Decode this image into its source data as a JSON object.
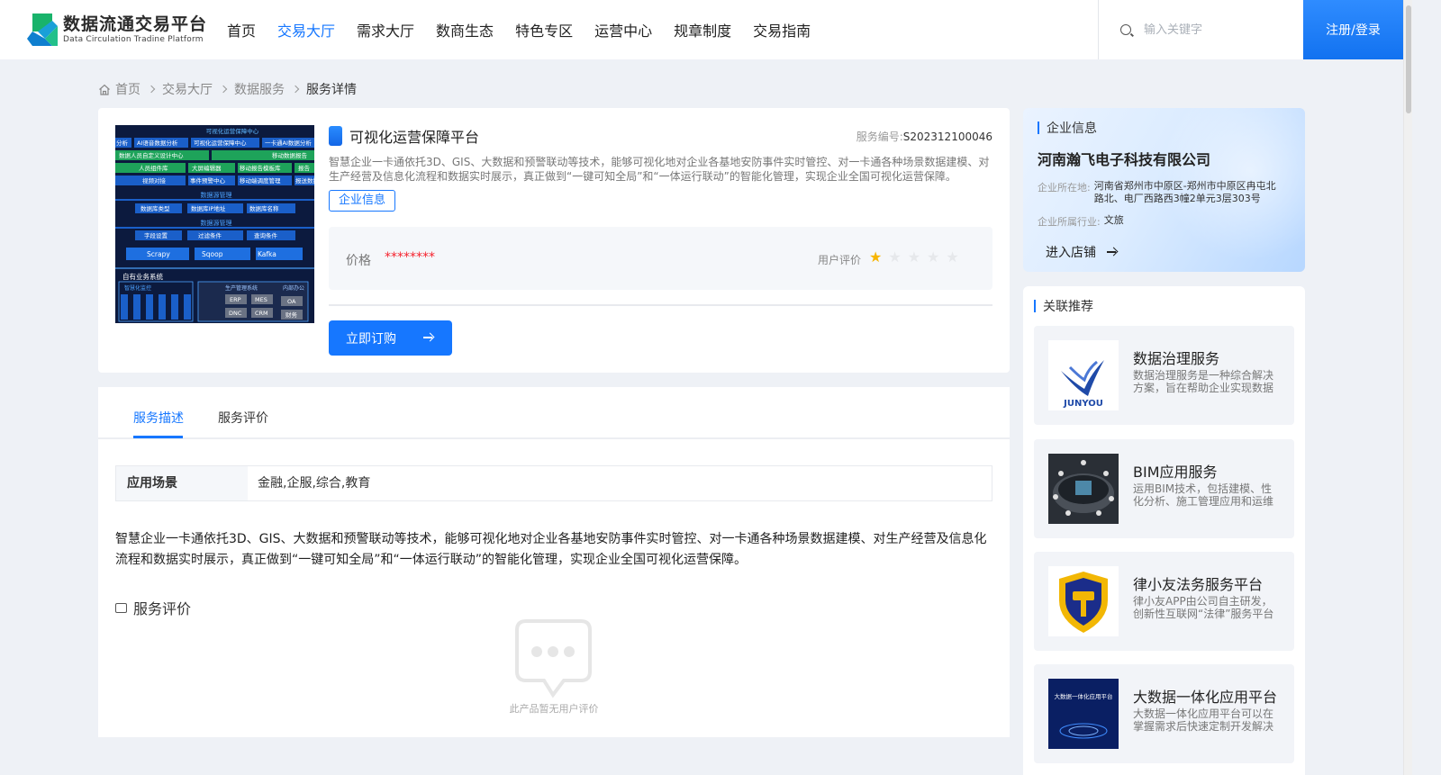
{
  "header": {
    "logo_title": "数据流通交易平台",
    "logo_sub": "Data Circulation Tradine Platform",
    "nav": [
      "首页",
      "交易大厅",
      "需求大厅",
      "数商生态",
      "特色专区",
      "运营中心",
      "规章制度",
      "交易指南"
    ],
    "active_nav": "交易大厅",
    "search_placeholder": "输入关键字",
    "login_label": "注册/登录"
  },
  "breadcrumb": [
    "首页",
    "交易大厅",
    "数据服务",
    "服务详情"
  ],
  "product": {
    "title": "可视化运营保障平台",
    "code_label": "服务编号:",
    "code": "S202312100046",
    "description": "智慧企业一卡通依托3D、GIS、大数据和预警联动等技术，能够可视化地对企业各基地安防事件实时管控、对一卡通各种场景数据建模、对生产经营及信息化流程和数据实时展示，真正做到“一键可知全局”和“一体运行联动”的智能化管理，实现企业全国可视化运营保障。",
    "enterprise_tag": "企业信息",
    "price_label": "价格",
    "price_value": "********",
    "rating_label": "用户评价",
    "rating": 1,
    "rating_max": 5,
    "order_label": "立即订购",
    "thumbnail": {
      "header_text": "可视化运营保障中心",
      "row1": [
        "分析",
        "AI语音数据分析",
        "可视化运营保障中心",
        "一卡通AI数据分析"
      ],
      "row2": [
        "数据人员自定义设计中心",
        "移动数据报告"
      ],
      "row3": [
        "人员组件库",
        "大屏编辑器",
        "移动报告模板库",
        "报告"
      ],
      "row4": [
        "视频对接",
        "事件预警中心",
        "移动端调度管理",
        "报送数据"
      ],
      "sec2": "数据源管理",
      "row5": [
        "数据库类型",
        "数据库IP地址",
        "数据库名称"
      ],
      "sec3": "数据源管理",
      "row6": [
        "字段设置",
        "过滤条件",
        "查询条件"
      ],
      "row7": [
        "Scrapy",
        "Sqoop",
        "Kafka"
      ],
      "sec4": "自有业务系统",
      "sub1": "智慧化监控",
      "sub2": "生产管理系统",
      "sub3": "内部办公",
      "modules": [
        "ERP",
        "MES",
        "DNC",
        "CRM",
        "OA",
        "财务"
      ]
    }
  },
  "detail": {
    "tabs": [
      "服务描述",
      "服务评价"
    ],
    "active_tab": "服务描述",
    "scene_label": "应用场景",
    "scene_value": "金融,企服,综合,教育",
    "full_description": "智慧企业一卡通依托3D、GIS、大数据和预警联动等技术，能够可视化地对企业各基地安防事件实时管控、对一卡通各种场景数据建模、对生产经营及信息化流程和数据实时展示，真正做到“一键可知全局”和“一体运行联动”的智能化管理，实现企业全国可视化运营保障。",
    "review_title": "服务评价",
    "empty_text": "此产品暂无用户评价"
  },
  "company": {
    "section_title": "企业信息",
    "name": "河南瀚飞电子科技有限公司",
    "location_label": "企业所在地:",
    "location": "河南省郑州市中原区-郑州市中原区冉屯北路北、电厂西路西3幢2单元3层303号",
    "industry_label": "企业所属行业:",
    "industry": "文旅",
    "enter_label": "进入店铺"
  },
  "recommend": {
    "section_title": "关联推荐",
    "items": [
      {
        "title": "数据治理服务",
        "desc": "数据治理服务是一种综合解决方案，旨在帮助企业实现数据的有效管理",
        "logo_text": "JUNYOU"
      },
      {
        "title": "BIM应用服务",
        "desc": "运用BIM技术，包括建模、性化分析、施工管理应用和运维管理",
        "logo_text": ""
      },
      {
        "title": "律小友法务服务平台",
        "desc": "律小友APP由公司自主研发，创新性互联网“法律”服务平台",
        "logo_text": ""
      },
      {
        "title": "大数据一体化应用平台",
        "desc": "大数据一体化应用平台可以在掌握需求后快速定制开发解决方案",
        "logo_text": "大数据一体化应用平台"
      }
    ]
  },
  "colors": {
    "accent": "#1677ff",
    "price": "#f5222d",
    "star": "#f7b500"
  }
}
